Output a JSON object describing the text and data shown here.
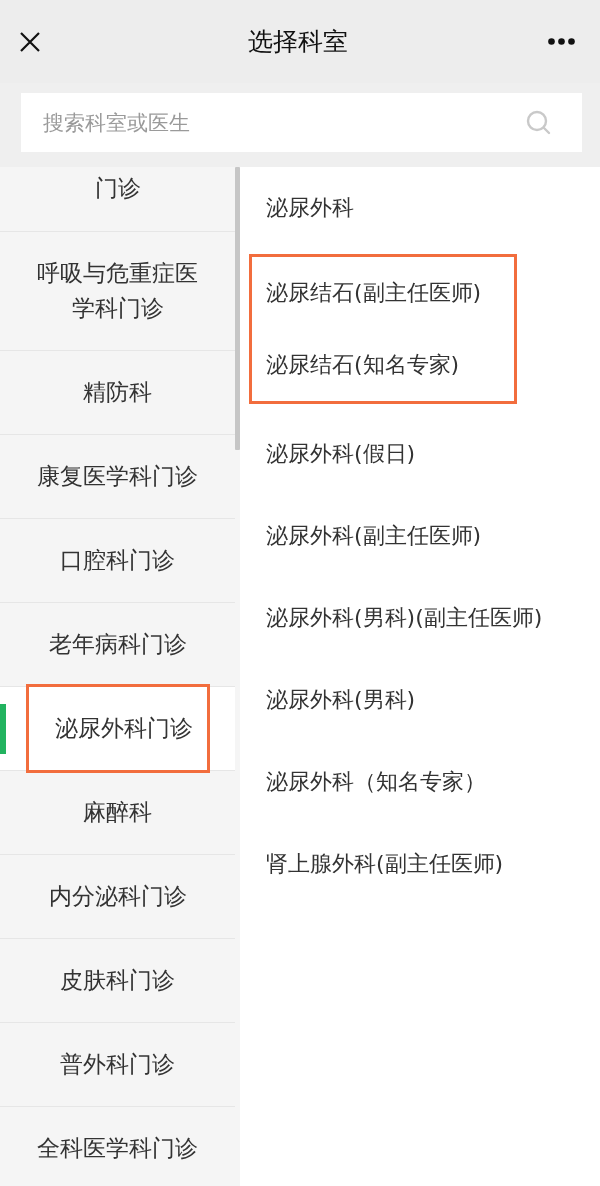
{
  "header": {
    "title": "选择科室"
  },
  "search": {
    "placeholder": "搜索科室或医生"
  },
  "departments": [
    {
      "label": "门诊",
      "selected": false,
      "highlighted": false
    },
    {
      "label": "呼吸与危重症医学科门诊",
      "selected": false,
      "highlighted": false
    },
    {
      "label": "精防科",
      "selected": false,
      "highlighted": false
    },
    {
      "label": "康复医学科门诊",
      "selected": false,
      "highlighted": false
    },
    {
      "label": "口腔科门诊",
      "selected": false,
      "highlighted": false
    },
    {
      "label": "老年病科门诊",
      "selected": false,
      "highlighted": false
    },
    {
      "label": "泌尿外科门诊",
      "selected": true,
      "highlighted": true
    },
    {
      "label": "麻醉科",
      "selected": false,
      "highlighted": false
    },
    {
      "label": "内分泌科门诊",
      "selected": false,
      "highlighted": false
    },
    {
      "label": "皮肤科门诊",
      "selected": false,
      "highlighted": false
    },
    {
      "label": "普外科门诊",
      "selected": false,
      "highlighted": false
    },
    {
      "label": "全科医学科门诊",
      "selected": false,
      "highlighted": false
    }
  ],
  "clinics": [
    {
      "kind": "item",
      "label": "泌尿外科"
    },
    {
      "kind": "highlight_group",
      "items": [
        {
          "label": "泌尿结石(副主任医师)"
        },
        {
          "label": "泌尿结石(知名专家)"
        }
      ]
    },
    {
      "kind": "item",
      "label": "泌尿外科(假日)"
    },
    {
      "kind": "item",
      "label": "泌尿外科(副主任医师)"
    },
    {
      "kind": "item",
      "label": "泌尿外科(男科)(副主任医师)"
    },
    {
      "kind": "item",
      "label": "泌尿外科(男科)"
    },
    {
      "kind": "item",
      "label": "泌尿外科（知名专家）"
    },
    {
      "kind": "item",
      "label": "肾上腺外科(副主任医师)"
    }
  ]
}
